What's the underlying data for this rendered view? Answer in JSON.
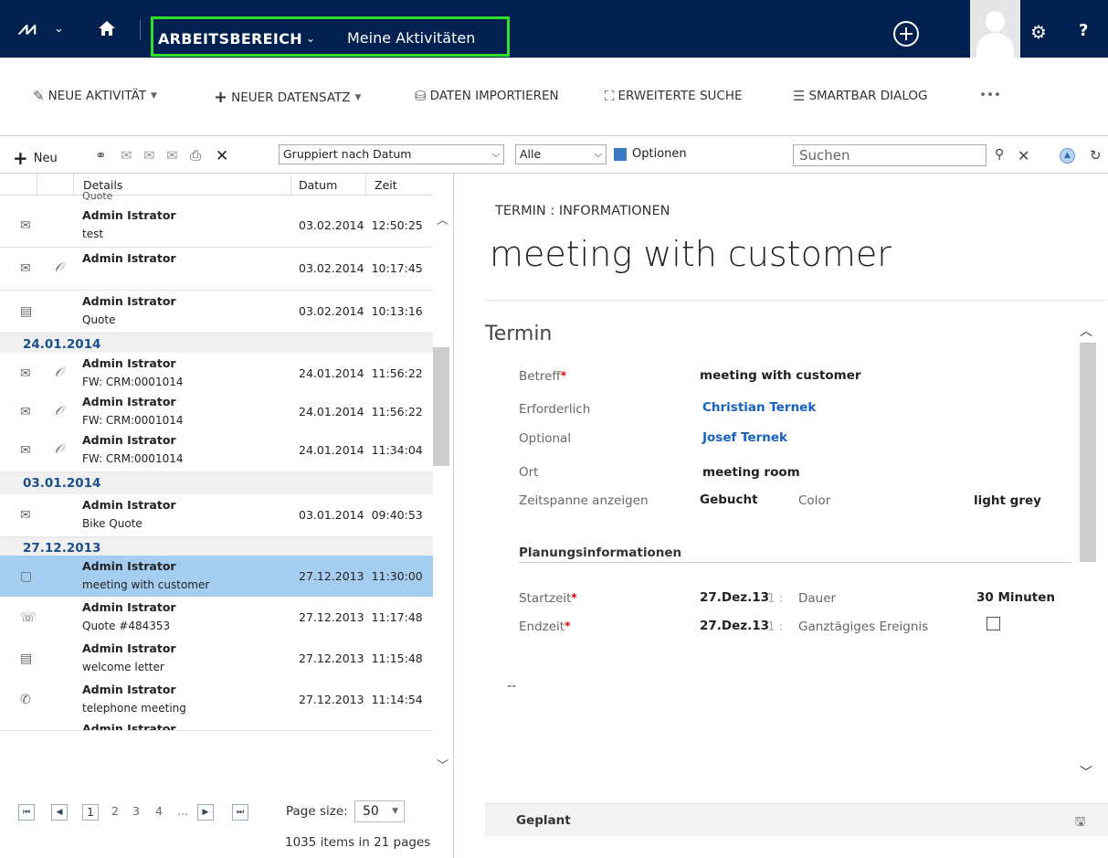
{
  "nav": {
    "area": "ARBEITSBEREICH",
    "page": "Meine Aktivitäten",
    "help": "?"
  },
  "command_bar": {
    "new_activity": "NEUE AKTIVITÄT",
    "new_record": "NEUER DATENSATZ",
    "import_data": "DATEN IMPORTIEREN",
    "advanced_find": "ERWEITERTE SUCHE",
    "smartbar_dialog": "SMARTBAR DIALOG",
    "more": "•••"
  },
  "grid_toolbar": {
    "new_label": "Neu",
    "view_select": "Gruppiert nach Datum",
    "filter_select": "Alle",
    "options_label": "Optionen",
    "search_placeholder": "Suchen"
  },
  "list": {
    "columns": {
      "details": "Details",
      "date": "Datum",
      "time": "Zeit"
    },
    "cut_top_text": "Quote",
    "rows_top": [
      {
        "icon": "email-icon",
        "attach": false,
        "who": "Admin Istrator",
        "subject": "test",
        "date": "03.02.2014",
        "time": "12:50:25"
      },
      {
        "icon": "email-icon",
        "attach": true,
        "who": "Admin Istrator",
        "subject": "",
        "date": "03.02.2014",
        "time": "10:17:45"
      },
      {
        "icon": "letter-icon",
        "attach": false,
        "who": "Admin Istrator",
        "subject": "Quote",
        "date": "03.02.2014",
        "time": "10:13:16"
      }
    ],
    "group1": "24.01.2014",
    "rows_g1": [
      {
        "icon": "email-icon",
        "attach": true,
        "who": "Admin Istrator",
        "subject": "FW: CRM:0001014",
        "date": "24.01.2014",
        "time": "11:56:22"
      },
      {
        "icon": "email-icon",
        "attach": true,
        "who": "Admin Istrator",
        "subject": "FW: CRM:0001014",
        "date": "24.01.2014",
        "time": "11:56:22"
      },
      {
        "icon": "email-icon",
        "attach": true,
        "who": "Admin Istrator",
        "subject": "FW: CRM:0001014",
        "date": "24.01.2014",
        "time": "11:34:04"
      }
    ],
    "group2": "03.01.2014",
    "rows_g2": [
      {
        "icon": "email-icon",
        "attach": false,
        "who": "Admin Istrator",
        "subject": "Bike Quote",
        "date": "03.01.2014",
        "time": "09:40:53"
      }
    ],
    "group3": "27.12.2013",
    "rows_g3": [
      {
        "icon": "appointment-icon",
        "attach": false,
        "who": "Admin Istrator",
        "subject": "meeting with customer",
        "date": "27.12.2013",
        "time": "11:30:00",
        "selected": true
      },
      {
        "icon": "fax-icon",
        "attach": false,
        "who": "Admin Istrator",
        "subject": "Quote #484353",
        "date": "27.12.2013",
        "time": "11:17:48"
      },
      {
        "icon": "letter-icon",
        "attach": false,
        "who": "Admin Istrator",
        "subject": "welcome letter",
        "date": "27.12.2013",
        "time": "11:15:48"
      },
      {
        "icon": "phone-icon",
        "attach": false,
        "who": "Admin Istrator",
        "subject": "telephone meeting",
        "date": "27.12.2013",
        "time": "11:14:54"
      }
    ],
    "cut_bottom_text": "Admin Istrator",
    "pager": {
      "pages": [
        "1",
        "2",
        "3",
        "4",
        "..."
      ],
      "page_size_label": "Page size:",
      "page_size": "50",
      "count_text": "1035 items in 21 pages"
    }
  },
  "form": {
    "breadcrumb": "TERMIN : INFORMATIONEN",
    "title": "meeting with customer",
    "section": "Termin",
    "fields": {
      "subject_label": "Betreff",
      "subject_value": "meeting with customer",
      "required_label": "Erforderlich",
      "required_value": "Christian Ternek",
      "optional_label": "Optional",
      "optional_value": "Josef Ternek",
      "location_label": "Ort",
      "location_value": "meeting room",
      "showtime_label": "Zeitspanne anzeigen",
      "showtime_value": "Gebucht",
      "color_label": "Color",
      "color_value": "light grey"
    },
    "planning_header": "Planungsinformationen",
    "planning": {
      "start_label": "Startzeit",
      "start_value": "27.Dez.13",
      "start_time_cut": "1 :",
      "duration_label": "Dauer",
      "duration_value": "30 Minuten",
      "end_label": "Endzeit",
      "end_value": "27.Dez.13",
      "end_time_cut": "1 :",
      "allday_label": "Ganztägiges Ereignis"
    },
    "description_placeholder": "--",
    "footer_status": "Geplant"
  }
}
